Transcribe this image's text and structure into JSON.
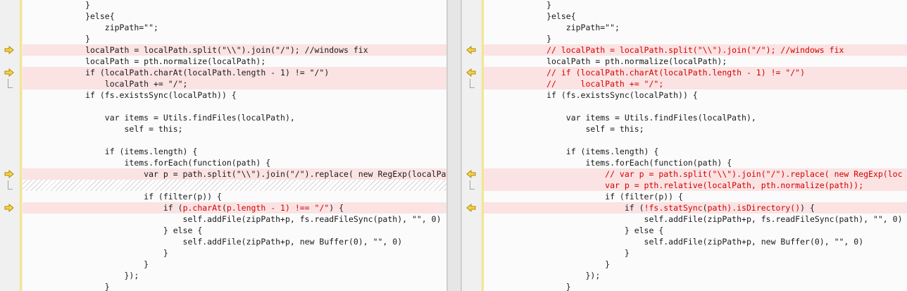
{
  "left": {
    "lines": [
      {
        "segs": [
          {
            "t": "            }"
          }
        ]
      },
      {
        "segs": [
          {
            "t": "            }else{"
          }
        ]
      },
      {
        "segs": [
          {
            "t": "                zipPath=\"\";"
          }
        ]
      },
      {
        "segs": [
          {
            "t": "            }"
          }
        ]
      },
      {
        "segs": [
          {
            "t": "            localPath = localPath.split(\"\\\\\").join(\"/\"); //windows fix"
          }
        ]
      },
      {
        "segs": [
          {
            "t": "            localPath = pth.normalize(localPath);"
          }
        ]
      },
      {
        "segs": [
          {
            "t": "            if (localPath.charAt(localPath.length - 1) != \"/\")"
          }
        ]
      },
      {
        "segs": [
          {
            "t": "                localPath += \"/\";"
          }
        ]
      },
      {
        "segs": [
          {
            "t": "            if (fs.existsSync(localPath)) {"
          }
        ]
      },
      {
        "segs": [
          {
            "t": ""
          }
        ]
      },
      {
        "segs": [
          {
            "t": "                var items = Utils.findFiles(localPath),"
          }
        ]
      },
      {
        "segs": [
          {
            "t": "                    self = this;"
          }
        ]
      },
      {
        "segs": [
          {
            "t": ""
          }
        ]
      },
      {
        "segs": [
          {
            "t": "                if (items.length) {"
          }
        ]
      },
      {
        "segs": [
          {
            "t": "                    items.forEach(function(path) {"
          }
        ]
      },
      {
        "segs": [
          {
            "t": "                        var p = path.split(\"\\\\\").join(\"/\").replace( new RegExp(localPa"
          }
        ]
      },
      {
        "segs": [
          {
            "t": ""
          }
        ]
      },
      {
        "segs": [
          {
            "t": "                        if (filter(p)) {"
          }
        ]
      },
      {
        "segs": [
          {
            "t": "                            if ("
          },
          {
            "t": "p.charAt",
            "r": true
          },
          {
            "t": "("
          },
          {
            "t": "p.length - 1) !== \"/\"",
            "r": true
          },
          {
            "t": ") {"
          }
        ]
      },
      {
        "segs": [
          {
            "t": "                                self.addFile(zipPath+p, fs.readFileSync(path), \"\", 0)"
          }
        ]
      },
      {
        "segs": [
          {
            "t": "                            } else {"
          }
        ]
      },
      {
        "segs": [
          {
            "t": "                                self.addFile(zipPath+p, new Buffer(0), \"\", 0)"
          }
        ]
      },
      {
        "segs": [
          {
            "t": "                            }"
          }
        ]
      },
      {
        "segs": [
          {
            "t": "                        }"
          }
        ]
      },
      {
        "segs": [
          {
            "t": "                    });"
          }
        ]
      },
      {
        "segs": [
          {
            "t": "                }"
          }
        ]
      },
      {
        "segs": [
          {
            "t": "            } else {"
          }
        ]
      }
    ]
  },
  "right": {
    "lines": [
      {
        "segs": [
          {
            "t": "            }"
          }
        ]
      },
      {
        "segs": [
          {
            "t": "            }else{"
          }
        ]
      },
      {
        "segs": [
          {
            "t": "                zipPath=\"\";"
          }
        ]
      },
      {
        "segs": [
          {
            "t": "            }"
          }
        ]
      },
      {
        "segs": [
          {
            "t": "            // localPath = localPath.split(\"\\\\\").join(\"/\"); //windows fix",
            "r": true
          }
        ]
      },
      {
        "segs": [
          {
            "t": "            localPath = pth.normalize(localPath);"
          }
        ]
      },
      {
        "segs": [
          {
            "t": "            // if (localPath.charAt(localPath.length - 1) != \"/\")",
            "r": true
          }
        ]
      },
      {
        "segs": [
          {
            "t": "            //     localPath += \"/\";",
            "r": true
          }
        ]
      },
      {
        "segs": [
          {
            "t": "            if (fs.existsSync(localPath)) {"
          }
        ]
      },
      {
        "segs": [
          {
            "t": ""
          }
        ]
      },
      {
        "segs": [
          {
            "t": "                var items = Utils.findFiles(localPath),"
          }
        ]
      },
      {
        "segs": [
          {
            "t": "                    self = this;"
          }
        ]
      },
      {
        "segs": [
          {
            "t": ""
          }
        ]
      },
      {
        "segs": [
          {
            "t": "                if (items.length) {"
          }
        ]
      },
      {
        "segs": [
          {
            "t": "                    items.forEach(function(path) {"
          }
        ]
      },
      {
        "segs": [
          {
            "t": "                        // var p = path.split(\"\\\\\").join(\"/\").replace( new RegExp(loc",
            "r": true
          }
        ]
      },
      {
        "segs": [
          {
            "t": "                        var p = pth.relative(localPath, pth.normalize(path));",
            "r": true
          }
        ]
      },
      {
        "segs": [
          {
            "t": "                        if (filter(p)) {"
          }
        ]
      },
      {
        "segs": [
          {
            "t": "                            if ("
          },
          {
            "t": "!fs.statSync",
            "r": true
          },
          {
            "t": "("
          },
          {
            "t": "path).isDirectory()",
            "r": true
          },
          {
            "t": ") {"
          }
        ]
      },
      {
        "segs": [
          {
            "t": "                                self.addFile(zipPath+p, fs.readFileSync(path), \"\", 0)"
          }
        ]
      },
      {
        "segs": [
          {
            "t": "                            } else {"
          }
        ]
      },
      {
        "segs": [
          {
            "t": "                                self.addFile(zipPath+p, new Buffer(0), \"\", 0)"
          }
        ]
      },
      {
        "segs": [
          {
            "t": "                            }"
          }
        ]
      },
      {
        "segs": [
          {
            "t": "                        }"
          }
        ]
      },
      {
        "segs": [
          {
            "t": "                    });"
          }
        ]
      },
      {
        "segs": [
          {
            "t": "                }"
          }
        ]
      },
      {
        "segs": [
          {
            "t": "            } else {"
          }
        ]
      }
    ]
  },
  "left_diff_rows": [
    4,
    6,
    7,
    15,
    18
  ],
  "left_hatch_rows": [
    16
  ],
  "right_diff_rows": [
    4,
    6,
    7,
    15,
    16,
    18
  ],
  "colors": {
    "diff_bg": "#fbe3e3",
    "changed_text": "#d40000",
    "change_bar": "#f4e58a",
    "marker": "#c8a000"
  },
  "icons": {
    "left_marker": "arrow-right-icon",
    "right_marker": "arrow-left-icon"
  }
}
